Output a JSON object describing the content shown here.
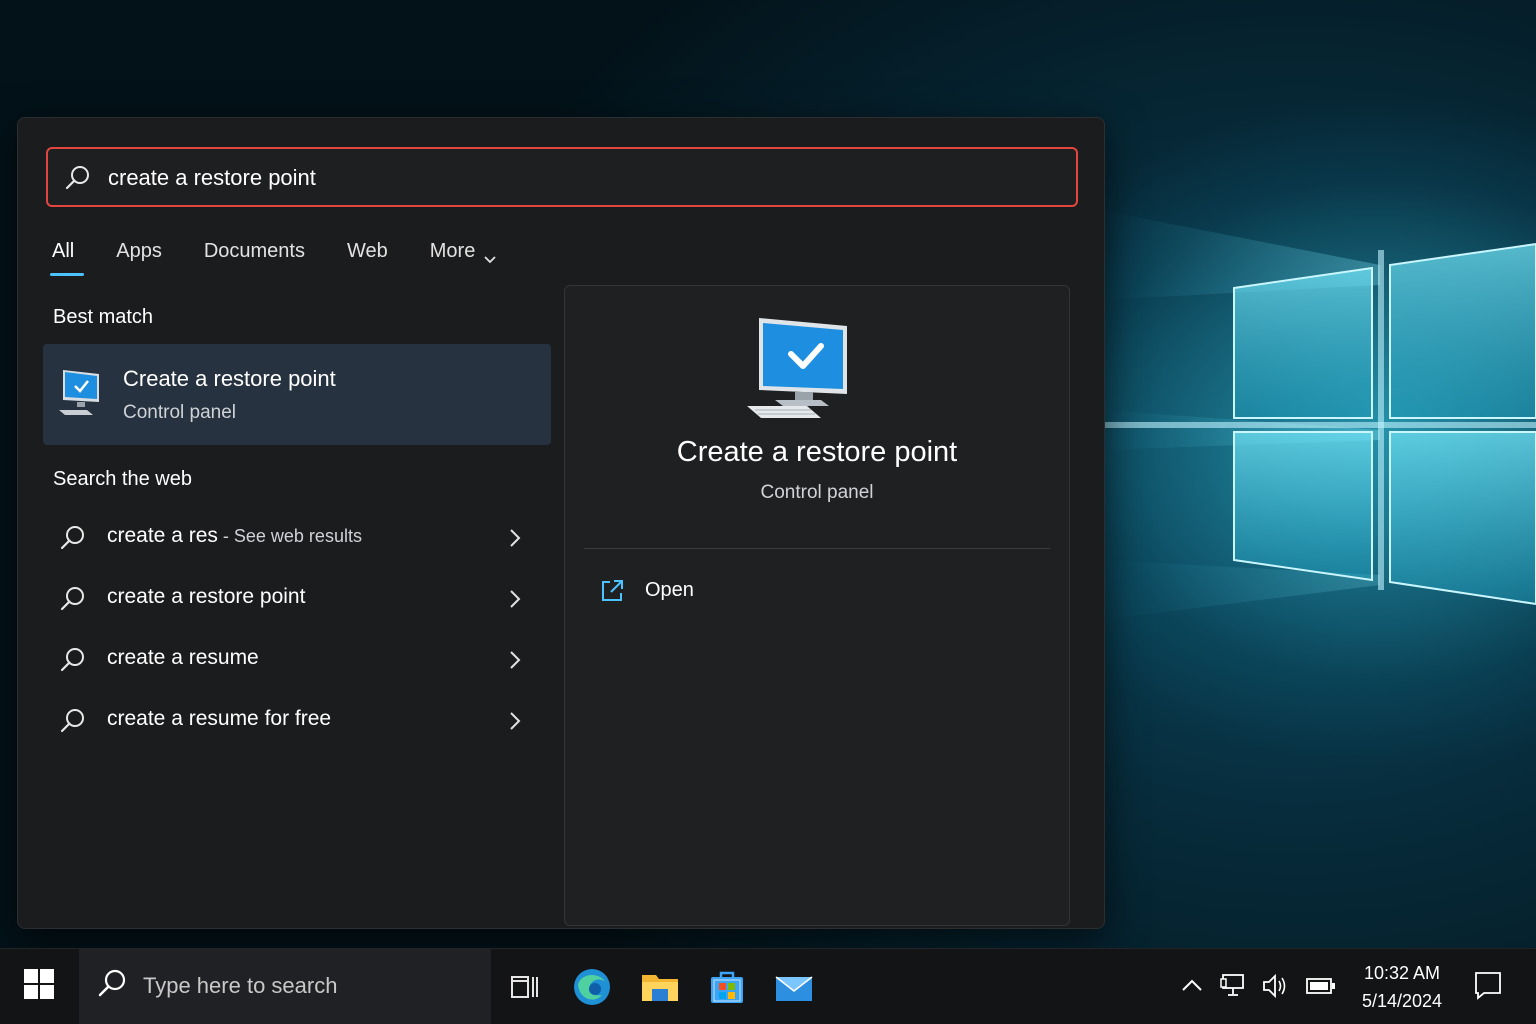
{
  "search": {
    "query": "create a restore point"
  },
  "tabs": [
    {
      "label": "All",
      "active": true
    },
    {
      "label": "Apps"
    },
    {
      "label": "Documents"
    },
    {
      "label": "Web"
    },
    {
      "label": "More"
    }
  ],
  "best_match": {
    "section_title": "Best match",
    "name": "Create a restore point",
    "subtitle": "Control panel",
    "icon": "computer-checkmark-icon"
  },
  "web": {
    "section_title": "Search the web",
    "results": [
      {
        "text": "create a res",
        "suffix": " - See web results"
      },
      {
        "text": "create a restore point",
        "suffix": ""
      },
      {
        "text": "create a resume",
        "suffix": ""
      },
      {
        "text": "create a resume for free",
        "suffix": ""
      }
    ]
  },
  "preview": {
    "title": "Create a restore point",
    "subtitle": "Control panel",
    "actions": [
      {
        "label": "Open",
        "icon": "open-external-icon"
      }
    ]
  },
  "taskbar": {
    "search_placeholder": "Type here to search",
    "apps": [
      "task-view-icon",
      "edge-icon",
      "file-explorer-icon",
      "store-icon",
      "mail-icon"
    ],
    "tray": [
      "chevron-up-icon",
      "network-icon",
      "volume-icon",
      "battery-icon"
    ],
    "time": "10:32 AM",
    "date": "5/14/2024"
  },
  "colors": {
    "accent": "#4cc2ff",
    "search_border": "#e2463f",
    "panel_bg": "#1b1c1e",
    "selected_bg": "#26323f"
  }
}
